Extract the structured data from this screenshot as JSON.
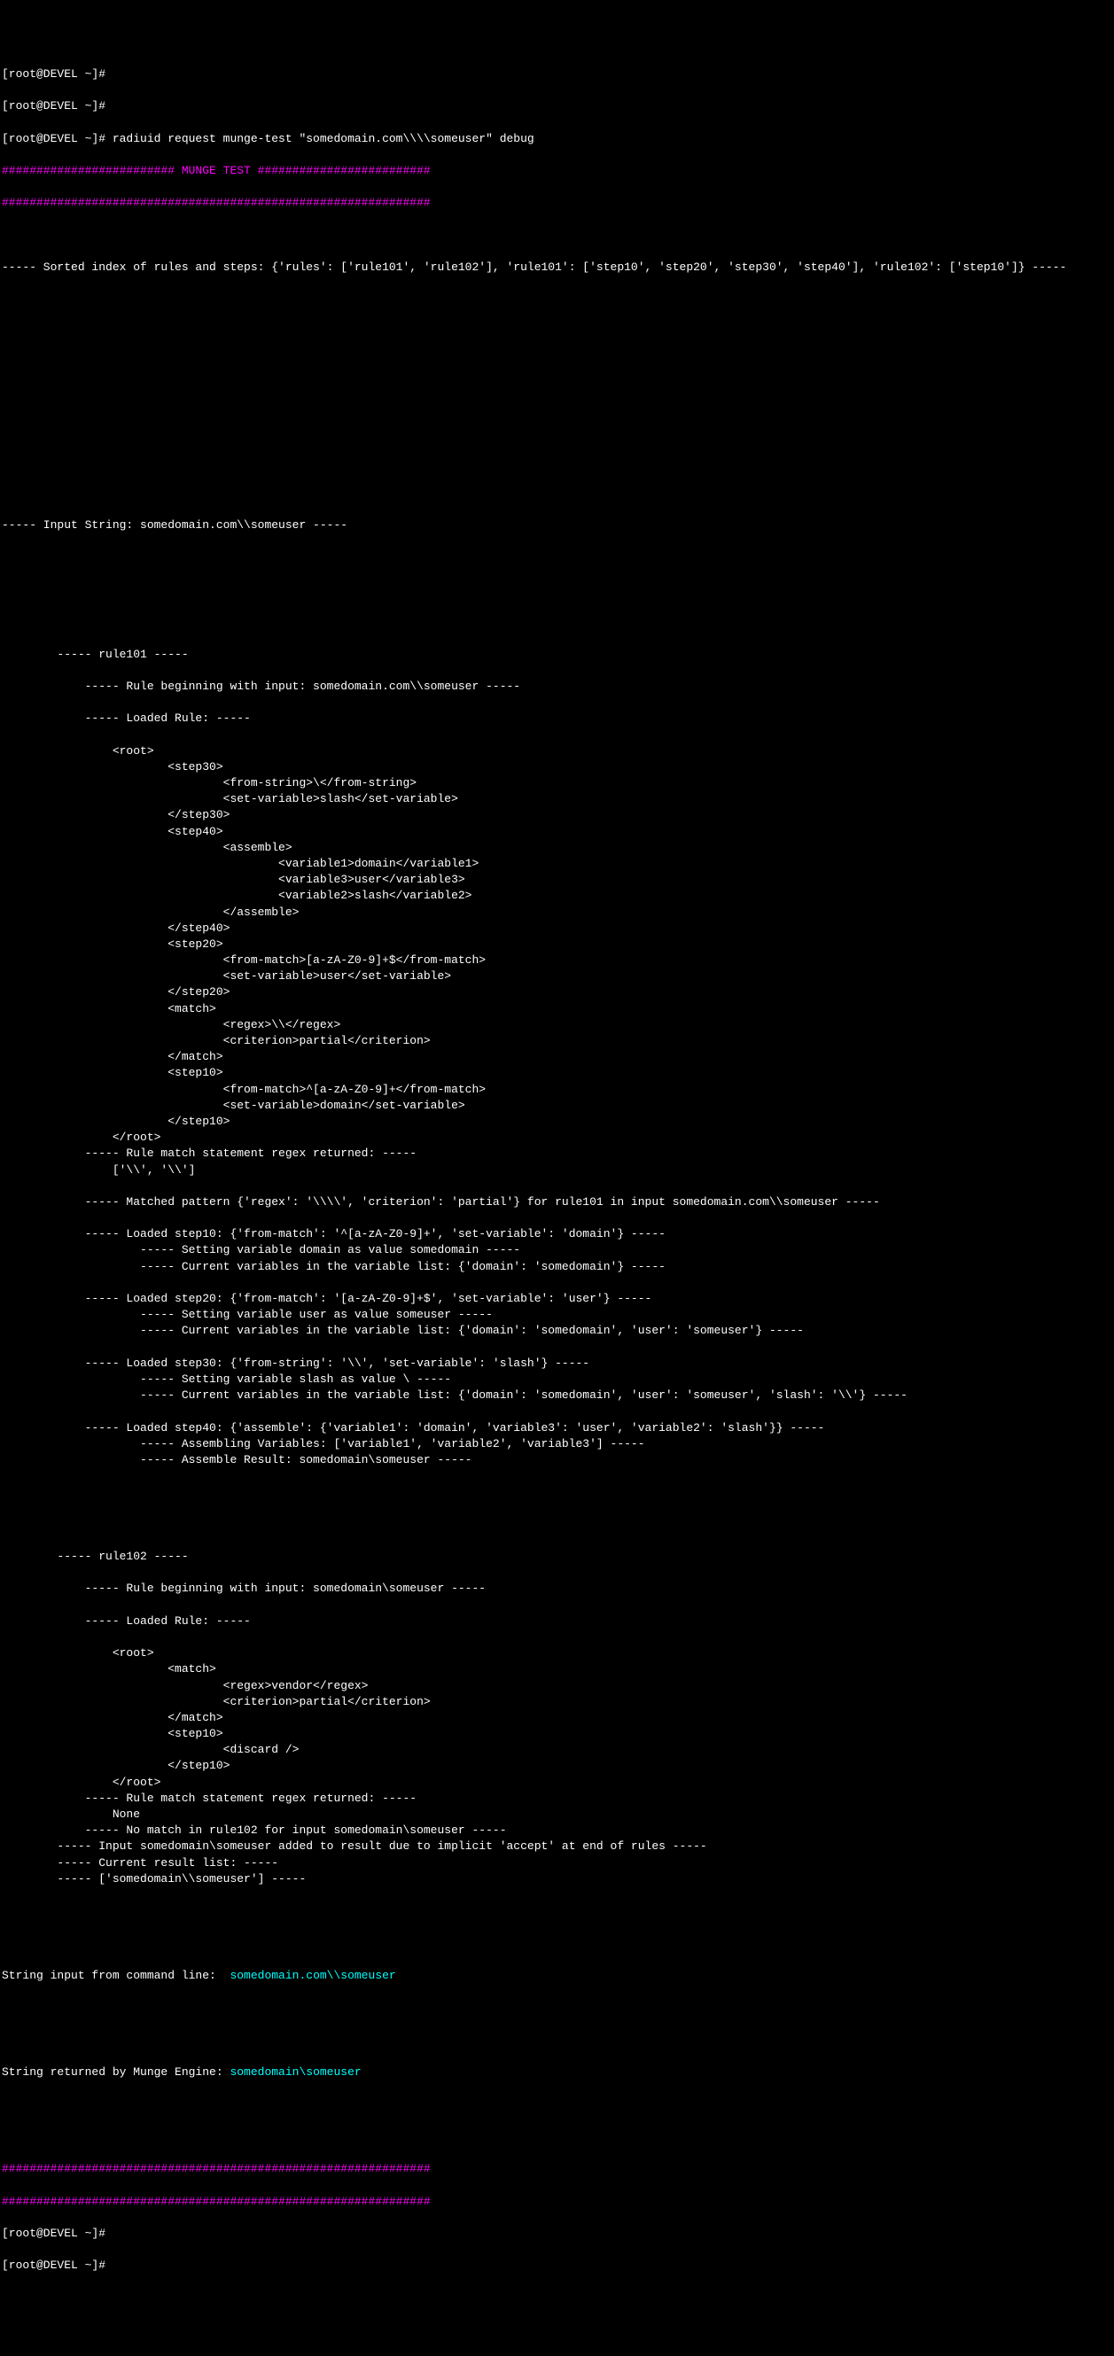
{
  "prompts": [
    "[root@DEVEL ~]#",
    "[root@DEVEL ~]#",
    "[root@DEVEL ~]# radiuid request munge-test \"somedomain.com\\\\\\\\someuser\" debug"
  ],
  "header1": "######################### MUNGE TEST #########################",
  "header2": "##############################################################",
  "sortedIndex": "----- Sorted index of rules and steps: {'rules': ['rule101', 'rule102'], 'rule101': ['step10', 'step20', 'step30', 'step40'], 'rule102': ['step10']} -----",
  "inputString": "----- Input String: somedomain.com\\\\someuser -----",
  "rule101": {
    "title": "        ----- rule101 -----",
    "begin": "            ----- Rule beginning with input: somedomain.com\\\\someuser -----",
    "loaded": "            ----- Loaded Rule: -----",
    "xml": [
      "                <root>",
      "                        <step30>",
      "                                <from-string>\\</from-string>",
      "                                <set-variable>slash</set-variable>",
      "                        </step30>",
      "                        <step40>",
      "                                <assemble>",
      "                                        <variable1>domain</variable1>",
      "                                        <variable3>user</variable3>",
      "                                        <variable2>slash</variable2>",
      "                                </assemble>",
      "                        </step40>",
      "                        <step20>",
      "                                <from-match>[a-zA-Z0-9]+$</from-match>",
      "                                <set-variable>user</set-variable>",
      "                        </step20>",
      "                        <match>",
      "                                <regex>\\\\</regex>",
      "                                <criterion>partial</criterion>",
      "                        </match>",
      "                        <step10>",
      "                                <from-match>^[a-zA-Z0-9]+</from-match>",
      "                                <set-variable>domain</set-variable>",
      "                        </step10>",
      "                </root>",
      "            ----- Rule match statement regex returned: -----",
      "                ['\\\\', '\\\\']",
      "",
      "            ----- Matched pattern {'regex': '\\\\\\\\', 'criterion': 'partial'} for rule101 in input somedomain.com\\\\someuser -----",
      "",
      "            ----- Loaded step10: {'from-match': '^[a-zA-Z0-9]+', 'set-variable': 'domain'} -----",
      "                    ----- Setting variable domain as value somedomain -----",
      "                    ----- Current variables in the variable list: {'domain': 'somedomain'} -----",
      "",
      "            ----- Loaded step20: {'from-match': '[a-zA-Z0-9]+$', 'set-variable': 'user'} -----",
      "                    ----- Setting variable user as value someuser -----",
      "                    ----- Current variables in the variable list: {'domain': 'somedomain', 'user': 'someuser'} -----",
      "",
      "            ----- Loaded step30: {'from-string': '\\\\', 'set-variable': 'slash'} -----",
      "                    ----- Setting variable slash as value \\ -----",
      "                    ----- Current variables in the variable list: {'domain': 'somedomain', 'user': 'someuser', 'slash': '\\\\'} -----",
      "",
      "            ----- Loaded step40: {'assemble': {'variable1': 'domain', 'variable3': 'user', 'variable2': 'slash'}} -----",
      "                    ----- Assembling Variables: ['variable1', 'variable2', 'variable3'] -----",
      "                    ----- Assemble Result: somedomain\\someuser -----"
    ]
  },
  "rule102": {
    "title": "        ----- rule102 -----",
    "begin": "            ----- Rule beginning with input: somedomain\\someuser -----",
    "loaded": "            ----- Loaded Rule: -----",
    "xml": [
      "                <root>",
      "                        <match>",
      "                                <regex>vendor</regex>",
      "                                <criterion>partial</criterion>",
      "                        </match>",
      "                        <step10>",
      "                                <discard />",
      "                        </step10>",
      "                </root>",
      "            ----- Rule match statement regex returned: -----",
      "                None",
      "            ----- No match in rule102 for input somedomain\\someuser -----",
      "        ----- Input somedomain\\someuser added to result due to implicit 'accept' at end of rules -----",
      "        ----- Current result list: -----",
      "        ----- ['somedomain\\\\someuser'] -----"
    ]
  },
  "inputLine": {
    "prefix": "String input from command line:  ",
    "value": "somedomain.com\\\\someuser"
  },
  "returnLine": {
    "prefix": "String returned by Munge Engine: ",
    "value": "somedomain\\someuser"
  },
  "footer1": "##############################################################",
  "footer2": "##############################################################",
  "footerPrompts": [
    "[root@DEVEL ~]#",
    "[root@DEVEL ~]#"
  ]
}
